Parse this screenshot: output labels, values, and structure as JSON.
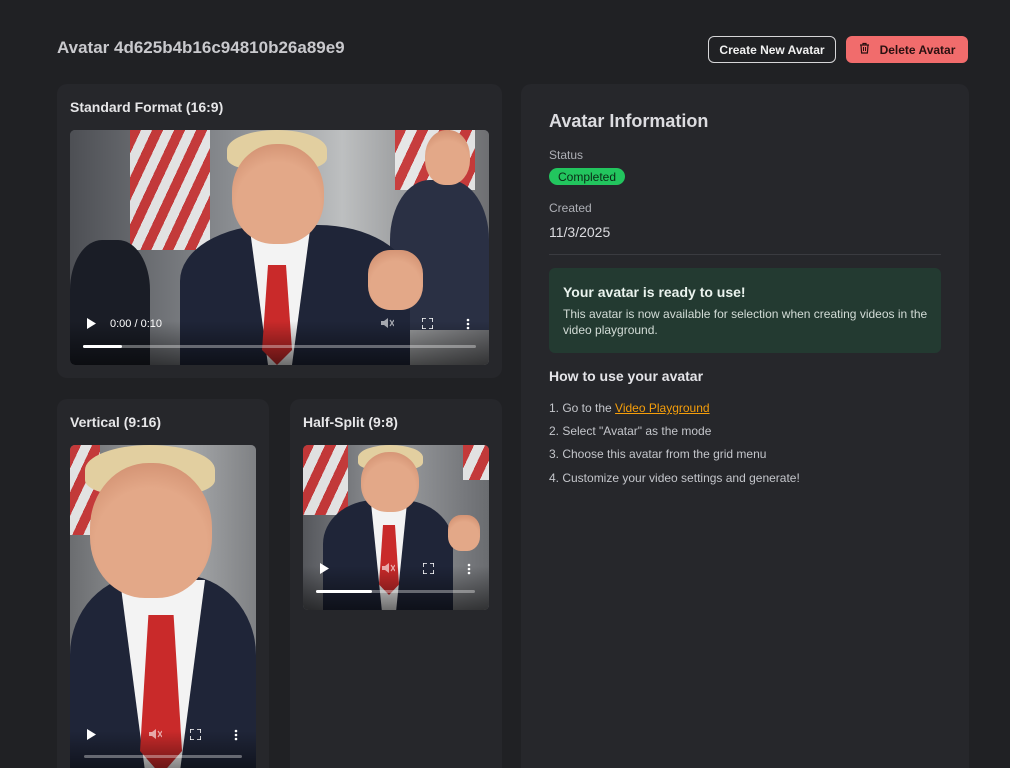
{
  "header": {
    "title": "Avatar 4d625b4b16c94810b26a89e9",
    "create_label": "Create New Avatar",
    "delete_label": "Delete Avatar"
  },
  "videos": {
    "standard": {
      "title": "Standard Format (16:9)",
      "time": "0:00 / 0:10",
      "progress": 0.1
    },
    "vertical": {
      "title": "Vertical (9:16)",
      "progress": 0.0
    },
    "half": {
      "title": "Half-Split (9:8)",
      "progress": 0.35
    }
  },
  "info": {
    "title": "Avatar Information",
    "status_label": "Status",
    "status_value": "Completed",
    "created_label": "Created",
    "created_value": "11/3/2025",
    "ready_title": "Your avatar is ready to use!",
    "ready_text": "This avatar is now available for selection when creating videos in the video playground.",
    "howto_title": "How to use your avatar",
    "step1_prefix": "1. Go to the ",
    "step1_link": "Video Playground",
    "step2": "2. Select \"Avatar\" as the mode",
    "step3": "3. Choose this avatar from the grid menu",
    "step4": "4. Customize your video settings and generate!"
  },
  "colors": {
    "background": "#202124",
    "card": "#26272b",
    "danger": "#f16c6c",
    "success": "#22c55e",
    "link": "#f59e0b"
  }
}
